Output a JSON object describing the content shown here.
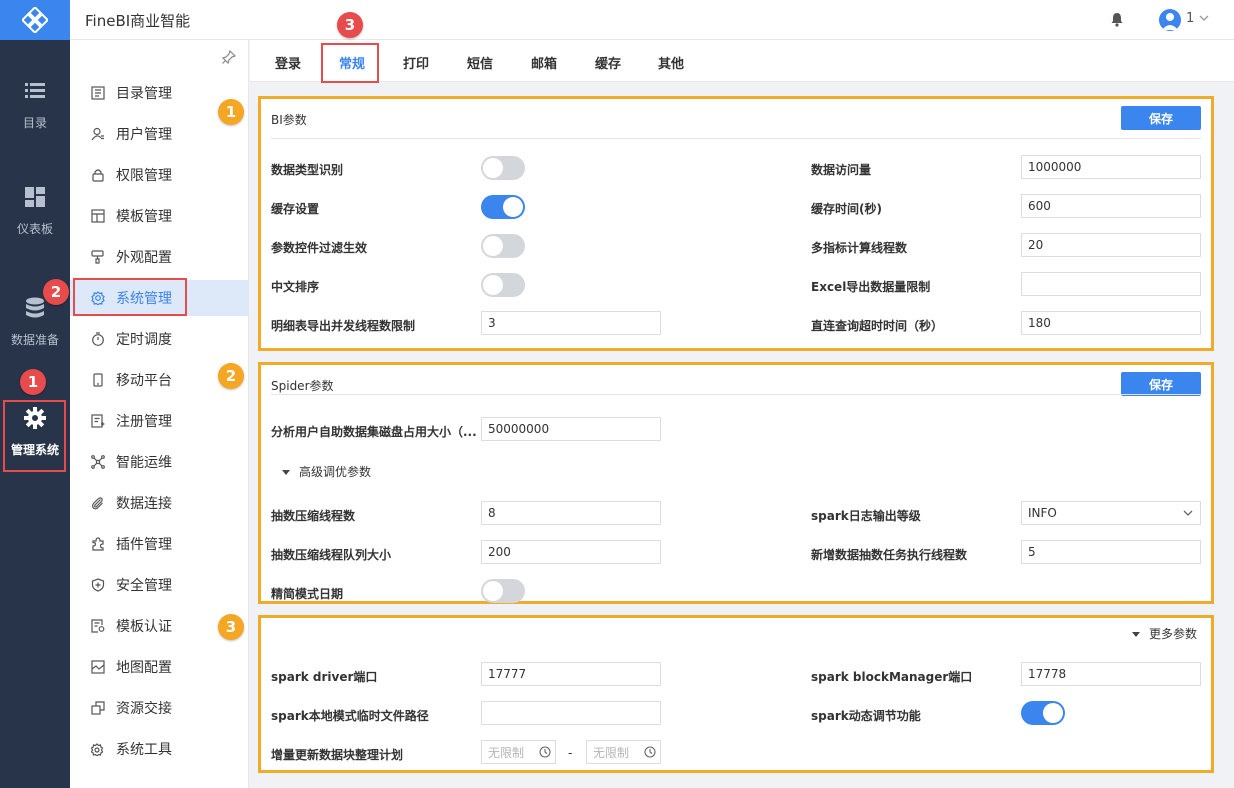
{
  "app": {
    "title": "FineBI商业智能",
    "user": "1"
  },
  "rail": [
    {
      "label": "目录",
      "icon": "list-icon"
    },
    {
      "label": "仪表板",
      "icon": "dashboard-icon"
    },
    {
      "label": "数据准备",
      "icon": "database-icon"
    },
    {
      "label": "管理系统",
      "icon": "gear-icon"
    }
  ],
  "sidebar": [
    "目录管理",
    "用户管理",
    "权限管理",
    "模板管理",
    "外观配置",
    "系统管理",
    "定时调度",
    "移动平台",
    "注册管理",
    "智能运维",
    "数据连接",
    "插件管理",
    "安全管理",
    "模板认证",
    "地图配置",
    "资源交接",
    "系统工具"
  ],
  "tabs": [
    "登录",
    "常规",
    "打印",
    "短信",
    "邮箱",
    "缓存",
    "其他"
  ],
  "save_label": "保存",
  "bi": {
    "title": "BI参数",
    "data_type_label": "数据类型识别",
    "cache_setting_label": "缓存设置",
    "param_filter_label": "参数控件过滤生效",
    "cn_sort_label": "中文排序",
    "detail_export_label": "明细表导出并发线程数限制",
    "detail_export_value": "3",
    "data_access_label": "数据访问量",
    "data_access_value": "1000000",
    "cache_time_label": "缓存时间(秒)",
    "cache_time_value": "600",
    "multi_calc_label": "多指标计算线程数",
    "multi_calc_value": "20",
    "excel_limit_label": "Excel导出数据量限制",
    "excel_limit_value": "",
    "direct_timeout_label": "直连查询超时时间（秒）",
    "direct_timeout_value": "180"
  },
  "spider": {
    "title": "Spider参数",
    "disk_label": "分析用户自助数据集磁盘占用大小（...",
    "disk_value": "50000000",
    "advanced_label": "高级调优参数",
    "compress_threads_label": "抽数压缩线程数",
    "compress_threads_value": "8",
    "compress_queue_label": "抽数压缩线程队列大小",
    "compress_queue_value": "200",
    "simple_mode_label": "精简模式日期",
    "spark_log_label": "spark日志输出等级",
    "spark_log_value": "INFO",
    "new_task_label": "新增数据抽数任务执行线程数",
    "new_task_value": "5"
  },
  "more": {
    "toggle_label": "更多参数",
    "driver_port_label": "spark driver端口",
    "driver_port_value": "17777",
    "local_path_label": "spark本地模式临时文件路径",
    "local_path_value": "",
    "incr_plan_label": "增量更新数据块整理计划",
    "time_placeholder": "无限制",
    "dash": "-",
    "bm_port_label": "spark blockManager端口",
    "bm_port_value": "17778",
    "dynamic_label": "spark动态调节功能"
  },
  "annotations": {
    "one": "1",
    "two": "2",
    "three": "3"
  },
  "colors": {
    "accent": "#3a85ee",
    "rail": "#283449",
    "highlight": "#f0ab2a",
    "marker": "#e84b4b"
  },
  "toggles": {
    "data_type": false,
    "cache_setting": true,
    "param_filter": false,
    "cn_sort": false,
    "simple_mode": false,
    "spark_dynamic": true
  }
}
